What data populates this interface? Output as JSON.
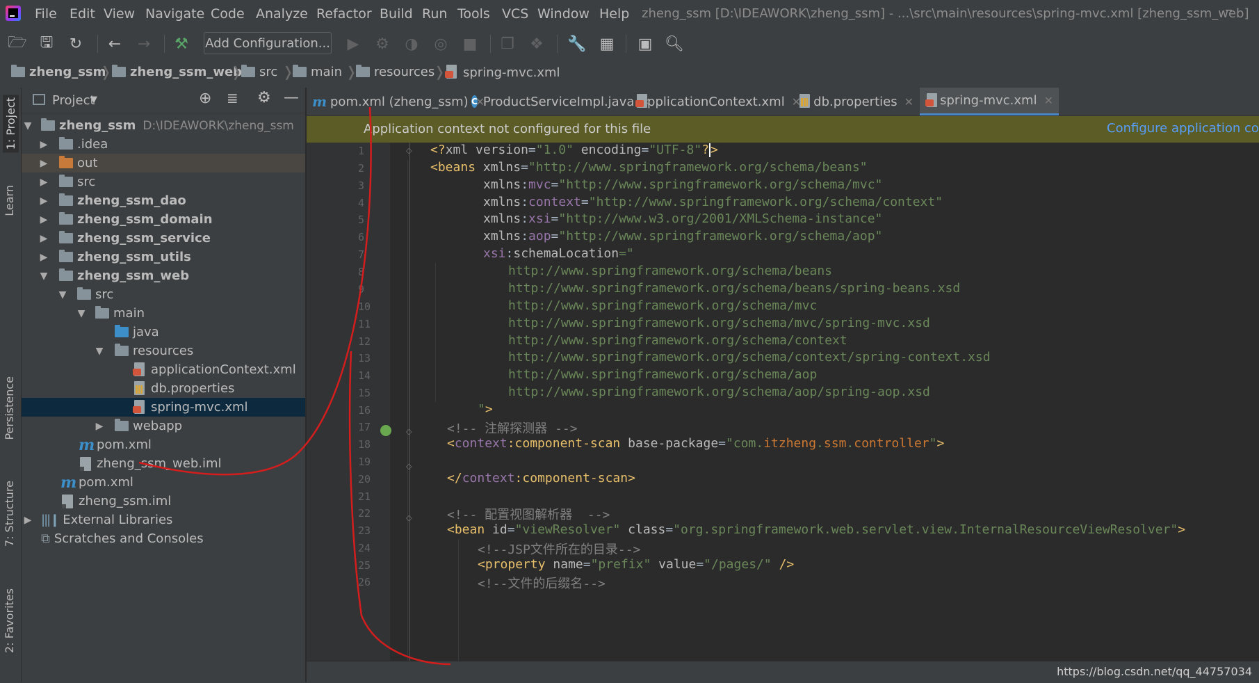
{
  "menu": {
    "items": [
      "File",
      "Edit",
      "View",
      "Navigate",
      "Code",
      "Analyze",
      "Refactor",
      "Build",
      "Run",
      "Tools",
      "VCS",
      "Window",
      "Help"
    ],
    "title": "zheng_ssm [D:\\IDEAWORK\\zheng_ssm] - ...\\src\\main\\resources\\spring-mvc.xml [zheng_ssm_web]"
  },
  "toolbar": {
    "add_configuration": "Add Configuration..."
  },
  "breadcrumbs": [
    "zheng_ssm",
    "zheng_ssm_web",
    "src",
    "main",
    "resources",
    "spring-mvc.xml"
  ],
  "stripe": {
    "project": "1: Project",
    "learn": "Learn",
    "persistence": "Persistence",
    "structure": "7: Structure",
    "favorites": "2: Favorites"
  },
  "project_panel": {
    "title": "Project",
    "root_path": "D:\\IDEAWORK\\zheng_ssm",
    "tree": [
      {
        "label": "zheng_ssm",
        "bold": true
      },
      {
        "label": ".idea"
      },
      {
        "label": "out"
      },
      {
        "label": "src"
      },
      {
        "label": "zheng_ssm_dao",
        "bold": true
      },
      {
        "label": "zheng_ssm_domain",
        "bold": true
      },
      {
        "label": "zheng_ssm_service",
        "bold": true
      },
      {
        "label": "zheng_ssm_utils",
        "bold": true
      },
      {
        "label": "zheng_ssm_web",
        "bold": true
      },
      {
        "label": "src"
      },
      {
        "label": "main"
      },
      {
        "label": "java"
      },
      {
        "label": "resources"
      },
      {
        "label": "applicationContext.xml"
      },
      {
        "label": "db.properties"
      },
      {
        "label": "spring-mvc.xml"
      },
      {
        "label": "webapp"
      },
      {
        "label": "pom.xml"
      },
      {
        "label": "zheng_ssm_web.iml"
      },
      {
        "label": "pom.xml"
      },
      {
        "label": "zheng_ssm.iml"
      },
      {
        "label": "External Libraries"
      },
      {
        "label": "Scratches and Consoles"
      }
    ]
  },
  "tabs": [
    "pom.xml (zheng_ssm)",
    "ProductServiceImpl.java",
    "applicationContext.xml",
    "db.properties",
    "spring-mvc.xml"
  ],
  "banner": {
    "text": "Application context not configured for this file",
    "link": "Configure application cont"
  },
  "editor": {
    "line_numbers": [
      "1",
      "2",
      "3",
      "4",
      "5",
      "6",
      "7",
      "8",
      "9",
      "10",
      "11",
      "12",
      "13",
      "14",
      "15",
      "16",
      "17",
      "18",
      "19",
      "20",
      "21",
      "22",
      "23",
      "24",
      "25",
      "26"
    ],
    "xml_decl": [
      "<?",
      "xml ",
      "version",
      "=",
      "\"1.0\"",
      "encoding",
      "=",
      "\"UTF-8\"",
      "?",
      ">"
    ],
    "beans_tag": "beans",
    "ns": {
      "xmlns": "xmlns",
      "mvc": "mvc",
      "context": "context",
      "xsi": "xsi",
      "aop": "aop",
      "schemaLocation": "schemaLocation"
    },
    "urls": {
      "beans": "\"http://www.springframework.org/schema/beans\"",
      "mvc": "\"http://www.springframework.org/schema/mvc\"",
      "context": "\"http://www.springframework.org/schema/context\"",
      "xsi": "\"http://www.w3.org/2001/XMLSchema-instance\"",
      "aop": "\"http://www.springframework.org/schema/aop\""
    },
    "schema_lines": [
      "http://www.springframework.org/schema/beans",
      "http://www.springframework.org/schema/beans/spring-beans.xsd",
      "http://www.springframework.org/schema/mvc",
      "http://www.springframework.org/schema/mvc/spring-mvc.xsd",
      "http://www.springframework.org/schema/context",
      "http://www.springframework.org/schema/context/spring-context.xsd",
      "http://www.springframework.org/schema/aop",
      "http://www.springframework.org/schema/aop/spring-aop.xsd"
    ],
    "schema_open": "=\"",
    "schema_close": "\">",
    "comment_scanner": "<!-- 注解探测器 -->",
    "component_scan_tag": "component-scan",
    "base_package_attr": "base-package",
    "base_package_val": [
      "\"com.",
      "itzheng",
      ".",
      "ssm",
      ".",
      "controller",
      "\""
    ],
    "comment_view": "<!-- 配置视图解析器  -->",
    "bean_tag": "bean",
    "id_attr": "id",
    "id_val": "\"viewResolver\"",
    "class_attr": "class",
    "class_val": "\"org.springframework.web.servlet.view.InternalResourceViewResolver\"",
    "comment_jsp": "<!--JSP文件所在的目录-->",
    "property_tag": "property",
    "name_attr": "name",
    "name_val": "\"prefix\"",
    "value_attr": "value",
    "value_val": "\"/pages/\"",
    "comment_suffix": "<!--文件的后缀名-->"
  },
  "watermark": "https://blog.csdn.net/qq_44757034"
}
